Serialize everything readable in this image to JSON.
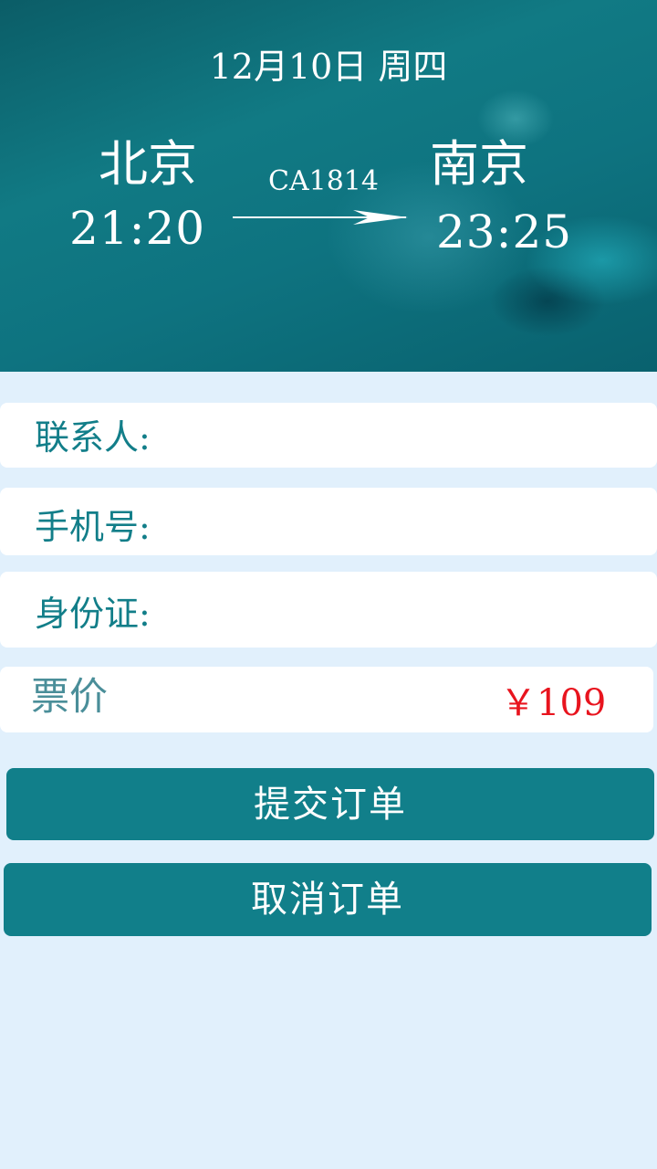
{
  "flight": {
    "date": "12月10日  周四",
    "departure_city": "北京",
    "departure_time": "21:20",
    "flight_number": "CA1814",
    "arrival_city": "南京",
    "arrival_time": "23:25"
  },
  "form": {
    "contact_label": "联系人:",
    "contact_value": "",
    "phone_label": "手机号:",
    "phone_value": "",
    "id_label": "身份证:",
    "id_value": "",
    "price_label": "票价",
    "price_value": "￥109"
  },
  "actions": {
    "submit_label": "提交订单",
    "cancel_label": "取消订单"
  },
  "colors": {
    "accent": "#117f8a",
    "label": "#127e89",
    "price": "#e8141e",
    "background": "#e1f0fc"
  }
}
